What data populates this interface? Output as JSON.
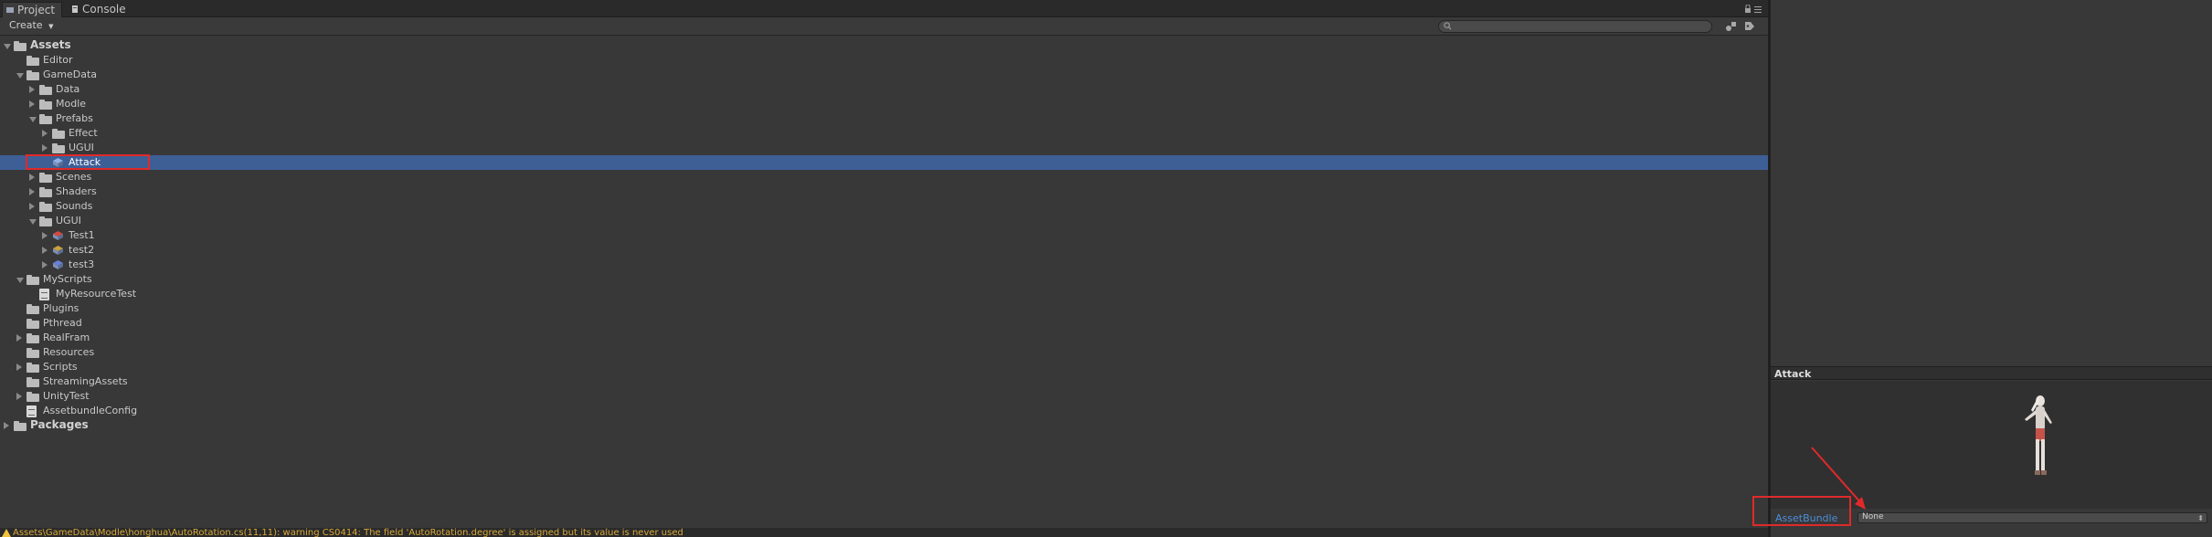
{
  "tabs": {
    "project": "Project",
    "console": "Console"
  },
  "toolbar": {
    "create_label": "Create",
    "search_placeholder": ""
  },
  "tree": [
    {
      "label": "Assets",
      "depth": 0,
      "expanded": true,
      "type": "root"
    },
    {
      "label": "Editor",
      "depth": 1,
      "expanded": null,
      "type": "folder"
    },
    {
      "label": "GameData",
      "depth": 1,
      "expanded": true,
      "type": "folder"
    },
    {
      "label": "Data",
      "depth": 2,
      "expanded": false,
      "type": "folder"
    },
    {
      "label": "Modle",
      "depth": 2,
      "expanded": false,
      "type": "folder"
    },
    {
      "label": "Prefabs",
      "depth": 2,
      "expanded": true,
      "type": "folder"
    },
    {
      "label": "Effect",
      "depth": 3,
      "expanded": false,
      "type": "folder"
    },
    {
      "label": "UGUI",
      "depth": 3,
      "expanded": false,
      "type": "folder"
    },
    {
      "label": "Attack",
      "depth": 3,
      "expanded": null,
      "type": "prefab",
      "selected": true
    },
    {
      "label": "Scenes",
      "depth": 2,
      "expanded": false,
      "type": "folder"
    },
    {
      "label": "Shaders",
      "depth": 2,
      "expanded": false,
      "type": "folder"
    },
    {
      "label": "Sounds",
      "depth": 2,
      "expanded": false,
      "type": "folder"
    },
    {
      "label": "UGUI",
      "depth": 2,
      "expanded": true,
      "type": "folder"
    },
    {
      "label": "Test1",
      "depth": 3,
      "expanded": false,
      "type": "prefab-red"
    },
    {
      "label": "test2",
      "depth": 3,
      "expanded": false,
      "type": "prefab-small"
    },
    {
      "label": "test3",
      "depth": 3,
      "expanded": false,
      "type": "prefab-blue"
    },
    {
      "label": "MyScripts",
      "depth": 1,
      "expanded": true,
      "type": "folder"
    },
    {
      "label": "MyResourceTest",
      "depth": 2,
      "expanded": null,
      "type": "script"
    },
    {
      "label": "Plugins",
      "depth": 1,
      "expanded": null,
      "type": "folder"
    },
    {
      "label": "Pthread",
      "depth": 1,
      "expanded": null,
      "type": "folder"
    },
    {
      "label": "RealFram",
      "depth": 1,
      "expanded": false,
      "type": "folder"
    },
    {
      "label": "Resources",
      "depth": 1,
      "expanded": null,
      "type": "folder"
    },
    {
      "label": "Scripts",
      "depth": 1,
      "expanded": false,
      "type": "folder"
    },
    {
      "label": "StreamingAssets",
      "depth": 1,
      "expanded": null,
      "type": "folder"
    },
    {
      "label": "UnityTest",
      "depth": 1,
      "expanded": false,
      "type": "folder"
    },
    {
      "label": "AssetbundleConfig",
      "depth": 1,
      "expanded": null,
      "type": "script"
    },
    {
      "label": "Packages",
      "depth": 0,
      "expanded": false,
      "type": "root"
    }
  ],
  "status": {
    "message": "Assets\\GameData\\Modle\\honghua\\AutoRotation.cs(11,11): warning CS0414: The field 'AutoRotation.degree' is assigned but its value is never used"
  },
  "inspector": {
    "preview_title": "Attack",
    "assetbundle_label": "AssetBundle",
    "assetbundle_value": "None"
  },
  "colors": {
    "selection": "#3e5f96",
    "highlight_box": "#e0292b",
    "assetbundle_link": "#4d8ed9",
    "warning": "#d9a93a"
  }
}
